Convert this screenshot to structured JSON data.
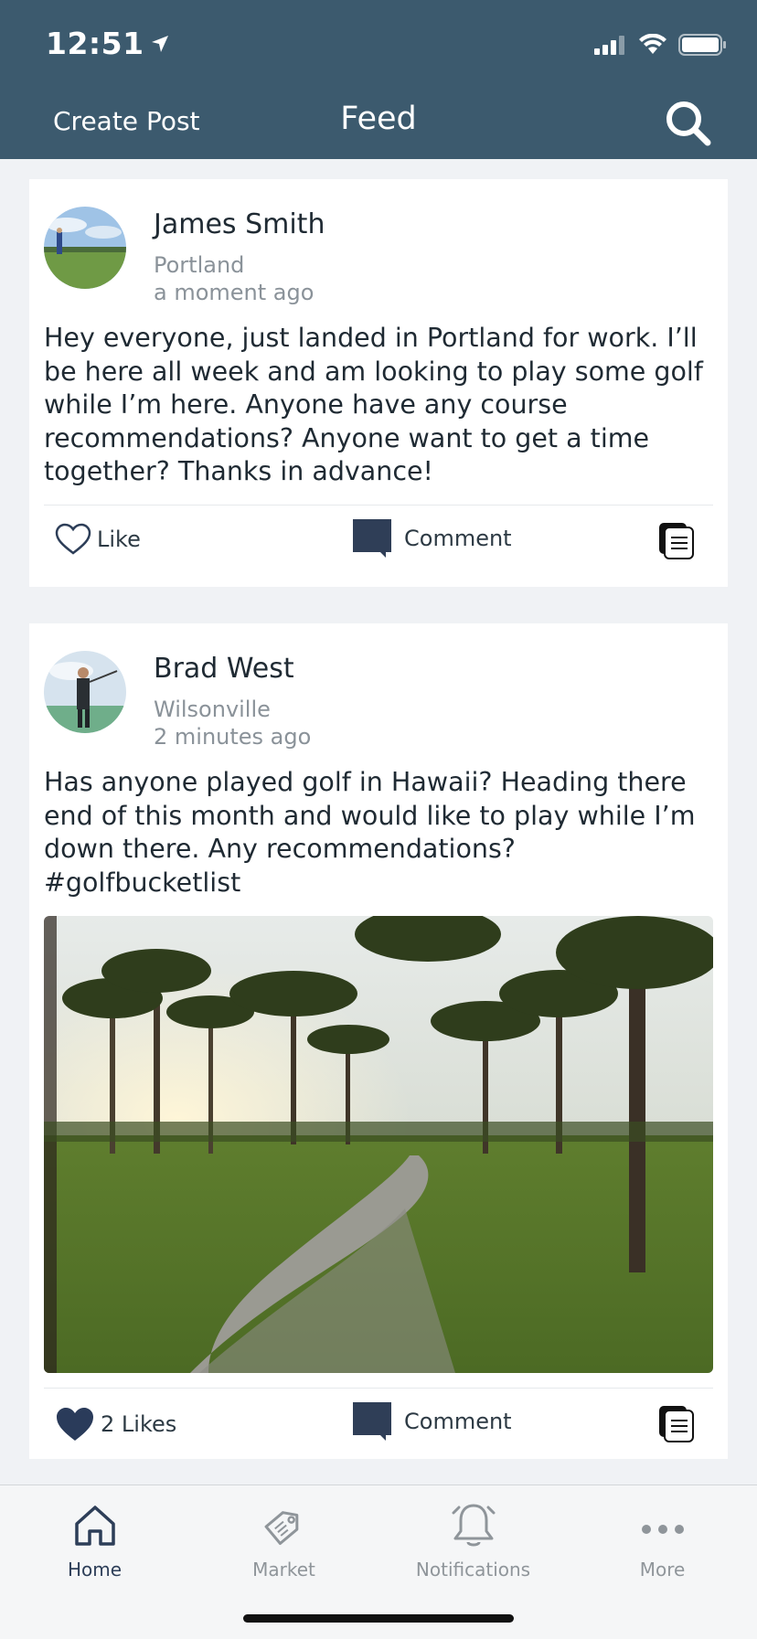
{
  "status_bar": {
    "time": "12:51"
  },
  "nav": {
    "create_label": "Create Post",
    "title": "Feed"
  },
  "posts": [
    {
      "author": "James Smith",
      "location": "Portland",
      "time": "a moment ago",
      "text": "Hey everyone, just landed in Portland for work. I’ll be here all week and am looking to play some golf while I’m here. Anyone have any course recommendations? Anyone want to get a time together? Thanks in advance!",
      "like_label": "Like",
      "liked": false,
      "comment_label": "Comment"
    },
    {
      "author": "Brad West",
      "location": "Wilsonville",
      "time": "2 minutes ago",
      "text": "Has anyone played golf in Hawaii? Heading there end of this month and would like to play while I’m down there. Any recommendations? #golfbucketlist",
      "like_label": "2 Likes",
      "liked": true,
      "comment_label": "Comment"
    }
  ],
  "tabs": [
    {
      "label": "Home",
      "icon": "home-icon",
      "active": true
    },
    {
      "label": "Market",
      "icon": "tag-icon",
      "active": false
    },
    {
      "label": "Notifications",
      "icon": "bell-icon",
      "active": false
    },
    {
      "label": "More",
      "icon": "more-icon",
      "active": false
    }
  ],
  "colors": {
    "header": "#3c5a6e",
    "accent": "#2d3e58",
    "inactive": "#8f959a"
  }
}
